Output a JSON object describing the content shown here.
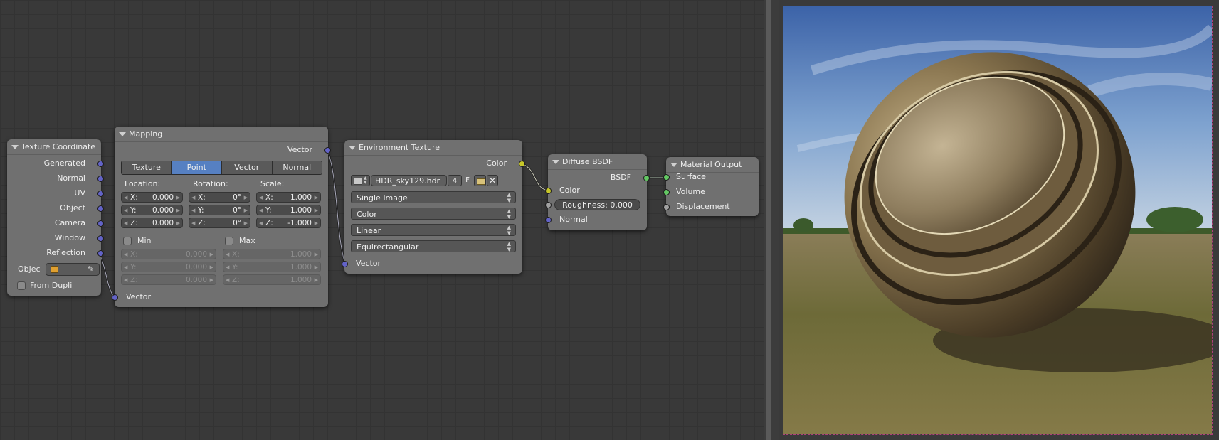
{
  "nodes": {
    "texcoord": {
      "title": "Texture Coordinate",
      "outputs": [
        "Generated",
        "Normal",
        "UV",
        "Object",
        "Camera",
        "Window",
        "Reflection"
      ],
      "object_label": "Objec",
      "from_dupli": "From Dupli"
    },
    "mapping": {
      "title": "Mapping",
      "output": "Vector",
      "tabs": [
        "Texture",
        "Point",
        "Vector",
        "Normal"
      ],
      "active_tab": "Point",
      "location_label": "Location:",
      "rotation_label": "Rotation:",
      "scale_label": "Scale:",
      "location": [
        {
          "axis": "X:",
          "value": "0.000"
        },
        {
          "axis": "Y:",
          "value": "0.000"
        },
        {
          "axis": "Z:",
          "value": "0.000"
        }
      ],
      "rotation": [
        {
          "axis": "X:",
          "value": "0°"
        },
        {
          "axis": "Y:",
          "value": "0°"
        },
        {
          "axis": "Z:",
          "value": "0°"
        }
      ],
      "scale": [
        {
          "axis": "X:",
          "value": "1.000"
        },
        {
          "axis": "Y:",
          "value": "1.000"
        },
        {
          "axis": "Z:",
          "value": "-1.000"
        }
      ],
      "min_label": "Min",
      "max_label": "Max",
      "min": [
        {
          "axis": "X:",
          "value": "0.000"
        },
        {
          "axis": "Y:",
          "value": "0.000"
        },
        {
          "axis": "Z:",
          "value": "0.000"
        }
      ],
      "max": [
        {
          "axis": "X:",
          "value": "1.000"
        },
        {
          "axis": "Y:",
          "value": "1.000"
        },
        {
          "axis": "Z:",
          "value": "1.000"
        }
      ],
      "input": "Vector"
    },
    "envtex": {
      "title": "Environment Texture",
      "output": "Color",
      "image_name": "HDR_sky129.hdr",
      "users": "4",
      "fake_user": "F",
      "source": "Single Image",
      "color_space": "Color",
      "interpolation": "Linear",
      "projection": "Equirectangular",
      "input": "Vector"
    },
    "diffuse": {
      "title": "Diffuse BSDF",
      "output": "BSDF",
      "color_input": "Color",
      "roughness": "Roughness: 0.000",
      "normal_input": "Normal"
    },
    "output": {
      "title": "Material Output",
      "inputs": [
        "Surface",
        "Volume",
        "Displacement"
      ]
    }
  },
  "colors": {
    "vector_socket": "#6363c7",
    "color_socket": "#c7c729",
    "shader_socket": "#63c763",
    "value_socket": "#a1a1a1",
    "active_tab": "#5680c2"
  }
}
